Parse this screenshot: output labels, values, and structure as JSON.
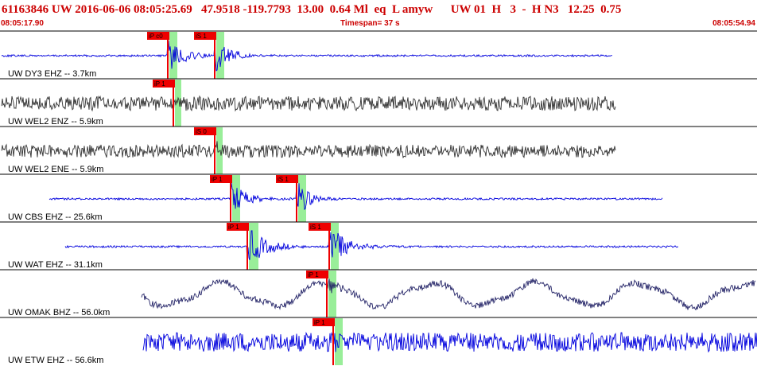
{
  "header": {
    "summary_line": "61163846 UW 2016-06-06 08:05:25.69   47.9518 -119.7793  13.00  0.64 Ml  eq  L amyw      UW 01  H   3  -  H N3   12.25  0.75",
    "start_time": "08:05:17.90",
    "timespan": "Timespan=  37 s",
    "end_time": "08:05:54.94"
  },
  "colors": {
    "trace_blue": "#0000dd",
    "trace_gray": "#333333",
    "trace_navy": "#222266",
    "pick": "#ee0000",
    "pick_window": "#99ee99",
    "text_red": "#cc0000"
  },
  "traces": [
    {
      "label": "UW DY3 EHZ -- 3.7km",
      "color": "blue",
      "picks": [
        {
          "text": "iP c0",
          "time": 8.2
        },
        {
          "text": "iS 1",
          "time": 10.5
        }
      ]
    },
    {
      "label": "UW WEL2 ENZ -- 5.9km",
      "color": "gray",
      "picks": [
        {
          "text": "iP 1",
          "time": 8.5
        }
      ]
    },
    {
      "label": "UW WEL2 ENE -- 5.9km",
      "color": "gray",
      "picks": [
        {
          "text": "iS 0",
          "time": 10.5
        }
      ]
    },
    {
      "label": "UW CBS EHZ -- 25.6km",
      "color": "blue",
      "picks": [
        {
          "text": "iP 1",
          "time": 11.3
        },
        {
          "text": "iS 1",
          "time": 14.5
        }
      ]
    },
    {
      "label": "UW WAT EHZ -- 31.1km",
      "color": "blue",
      "picks": [
        {
          "text": "iP 1",
          "time": 12.1
        },
        {
          "text": "iS 1",
          "time": 16.1
        }
      ]
    },
    {
      "label": "UW OMAK BHZ -- 56.0km",
      "color": "navy",
      "picks": [
        {
          "text": "iP 1",
          "time": 16.0
        }
      ]
    },
    {
      "label": "UW ETW EHZ -- 56.6km",
      "color": "blue",
      "picks": [
        {
          "text": "iP 1",
          "time": 16.3
        }
      ]
    }
  ]
}
